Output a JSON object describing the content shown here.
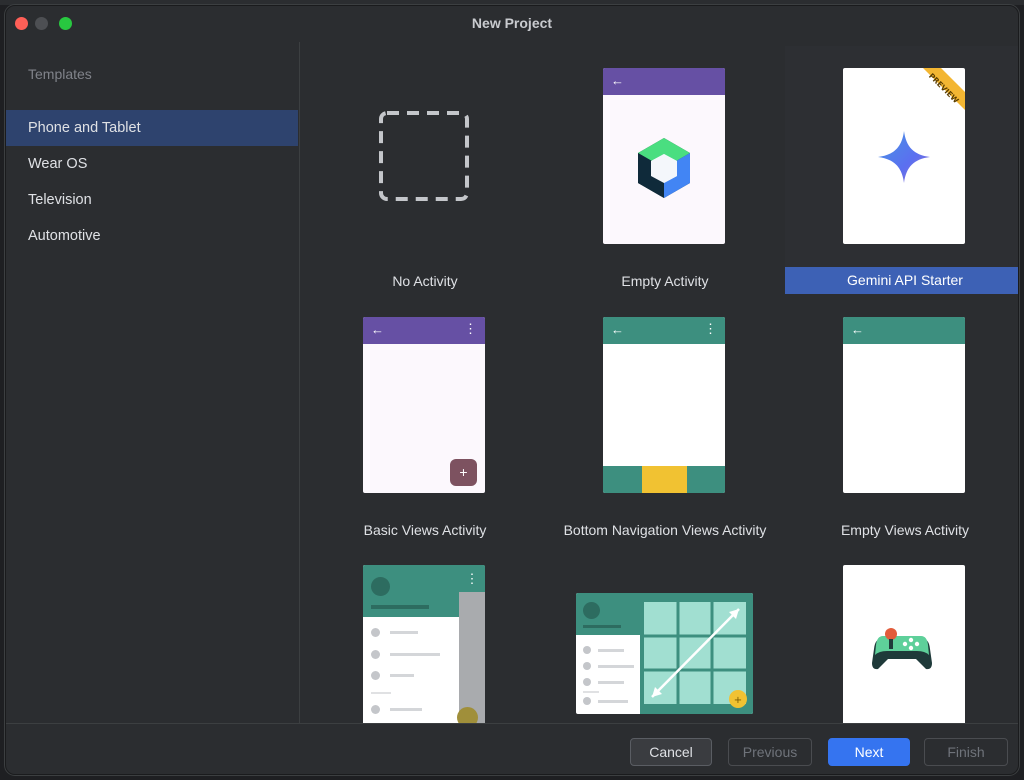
{
  "window": {
    "title": "New Project"
  },
  "sidebar": {
    "header": "Templates",
    "items": [
      {
        "label": "Phone and Tablet",
        "selected": true
      },
      {
        "label": "Wear OS",
        "selected": false
      },
      {
        "label": "Television",
        "selected": false
      },
      {
        "label": "Automotive",
        "selected": false
      }
    ]
  },
  "templates": [
    {
      "label": "No Activity",
      "selected": false
    },
    {
      "label": "Empty Activity",
      "selected": false
    },
    {
      "label": "Gemini API Starter",
      "selected": true,
      "badge": "PREVIEW"
    },
    {
      "label": "Basic Views Activity",
      "selected": false
    },
    {
      "label": "Bottom Navigation Views Activity",
      "selected": false
    },
    {
      "label": "Empty Views Activity",
      "selected": false
    },
    {
      "label": "",
      "selected": false
    },
    {
      "label": "",
      "selected": false
    },
    {
      "label": "",
      "selected": false
    }
  ],
  "footer": {
    "cancel": "Cancel",
    "previous": "Previous",
    "next": "Next",
    "finish": "Finish"
  },
  "colors": {
    "selection": "#3d61b5",
    "primary_button": "#3574f0",
    "compose_purple": "#6650a4",
    "views_teal": "#3d8f7f",
    "fab_maroon": "#7d5260",
    "fab_yellow": "#f1c232"
  }
}
